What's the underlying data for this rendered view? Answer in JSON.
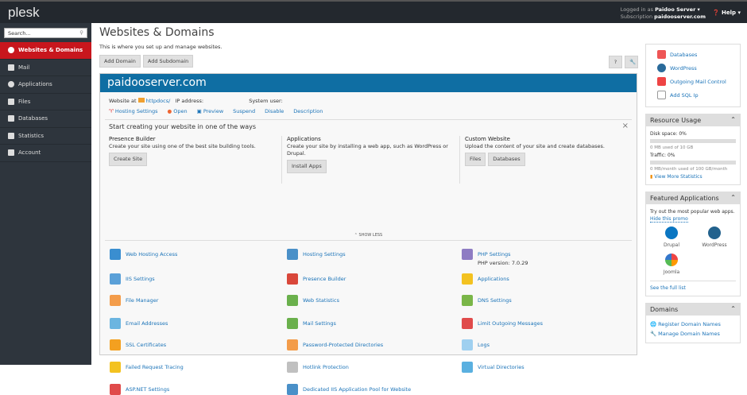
{
  "topbar": {
    "logo": "plesk",
    "logged_label": "Logged in as",
    "user": "Paidoo Server ▾",
    "sub_label": "Subscription",
    "subscription": "paidooserver.com",
    "help": "Help ▾"
  },
  "sidebar": {
    "search_placeholder": "Search...",
    "items": [
      {
        "label": "Websites & Domains"
      },
      {
        "label": "Mail"
      },
      {
        "label": "Applications"
      },
      {
        "label": "Files"
      },
      {
        "label": "Databases"
      },
      {
        "label": "Statistics"
      },
      {
        "label": "Account"
      }
    ]
  },
  "main": {
    "title": "Websites & Domains",
    "desc": "This is where you set up and manage websites.",
    "add_domain": "Add Domain",
    "add_subdomain": "Add Subdomain",
    "help_btn": "?",
    "tools_btn": "🔧",
    "domain": "paidooserver.com",
    "website_at": "Website at",
    "httpdocs": "httpdocs/",
    "ip_label": "IP address:",
    "sysuser_label": "System user:",
    "links": [
      "Hosting Settings",
      "Open",
      "Preview",
      "Suspend",
      "Disable",
      "Description"
    ],
    "start": {
      "title": "Start creating your website in one of the ways",
      "close": "×",
      "cols": [
        {
          "title": "Presence Builder",
          "text": "Create your site using one of the best site building tools.",
          "buttons": [
            "Create Site"
          ]
        },
        {
          "title": "Applications",
          "text": "Create your site by installing a web app, such as WordPress or Drupal.",
          "buttons": [
            "Install Apps"
          ]
        },
        {
          "title": "Custom Website",
          "text": "Upload the content of your site and create databases.",
          "buttons": [
            "Files",
            "Databases"
          ]
        }
      ]
    },
    "show_less": "⌃ SHOW LESS",
    "grid": [
      [
        "Web Hosting Access",
        "Hosting Settings",
        "PHP Settings"
      ],
      [
        "IIS Settings",
        "Presence Builder",
        "Applications"
      ],
      [
        "File Manager",
        "Web Statistics",
        "DNS Settings"
      ],
      [
        "Email Addresses",
        "Mail Settings",
        "Limit Outgoing Messages"
      ],
      [
        "SSL Certificates",
        "Password-Protected Directories",
        "Logs"
      ],
      [
        "Failed Request Tracing",
        "Hotlink Protection",
        "Virtual Directories"
      ],
      [
        "ASP.NET Settings",
        "Dedicated IIS Application Pool for Website",
        ""
      ]
    ],
    "php_version": "PHP version: 7.0.29"
  },
  "right": {
    "shortcuts": [
      "Databases",
      "WordPress",
      "Outgoing Mail Control",
      "Add SQL Ip"
    ],
    "resource": {
      "title": "Resource Usage",
      "disk": "Disk space: 0%",
      "disk_pct": 0,
      "disk_sub": "0 MB used of 10 GB",
      "traffic": "Traffic: 0%",
      "traffic_pct": 0,
      "traffic_sub": "0 MB/month used of 100 GB/month",
      "more": "View More Statistics"
    },
    "featured": {
      "title": "Featured Applications",
      "text": "Try out the most popular web apps.",
      "hide": "Hide this promo",
      "apps": [
        "Drupal",
        "WordPress",
        "Joomla"
      ],
      "full": "See the full list"
    },
    "domains": {
      "title": "Domains",
      "register": "Register Domain Names",
      "manage": "Manage Domain Names"
    }
  },
  "colors": {
    "topbar": "#23282e",
    "sidebar": "#2e353d",
    "active": "#c8161d",
    "domain_header": "#0f6ea3"
  }
}
